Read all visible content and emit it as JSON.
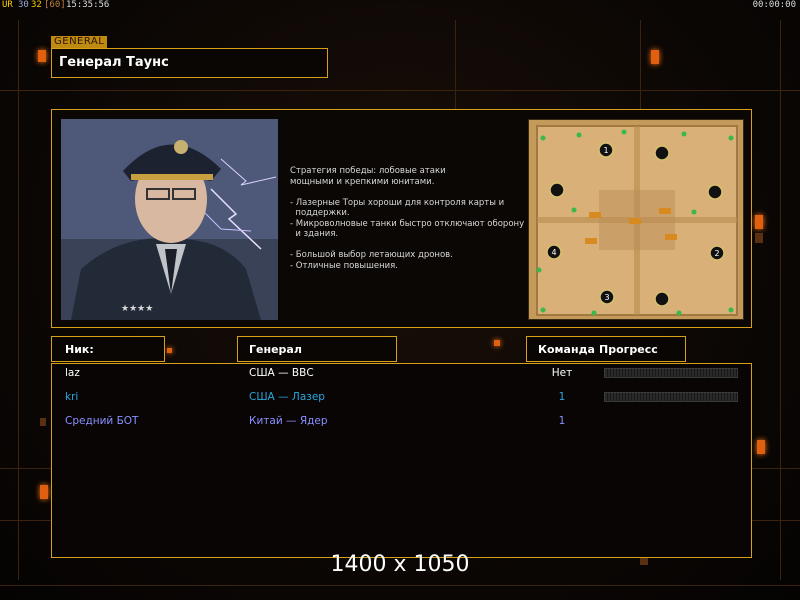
{
  "status": {
    "ur": "UR",
    "fps_a": "30",
    "fps_b": "32",
    "fps_c": "[60]",
    "clock": "15:35:56",
    "timer": "00:00:00"
  },
  "general_tag": "GENERAL",
  "general_name": "Генерал Таунс",
  "description": [
    "Стратегия победы: лобовые атаки",
    "мощными и крепкими юнитами.",
    "",
    "- Лазерные Торы хороши для контроля карты и",
    "  поддержки.",
    "- Микроволновые танки быстро отключают оборону",
    "  и здания.",
    "",
    "- Большой выбор летающих дронов.",
    "- Отличные повышения."
  ],
  "map": {
    "start_positions": [
      "1",
      "2",
      "3",
      "4"
    ]
  },
  "headers": {
    "nick": "Ник:",
    "general": "Генерал",
    "team": "Команда",
    "progress": "Прогресс"
  },
  "players": [
    {
      "nick": "laz",
      "general": "США — ВВС",
      "team": "Нет",
      "color": "#ffffff",
      "progress": 0
    },
    {
      "nick": "kri",
      "general": "США — Лазер",
      "team": "1",
      "color": "#2aa8e0",
      "progress": 0
    },
    {
      "nick": "Средний БОТ",
      "general": "Китай — Ядер",
      "team": "1",
      "color": "#8a90ff",
      "progress": null
    }
  ],
  "watermark": "1400 x 1050",
  "colors": {
    "frame": "#d8a018",
    "accent": "#e06010"
  }
}
